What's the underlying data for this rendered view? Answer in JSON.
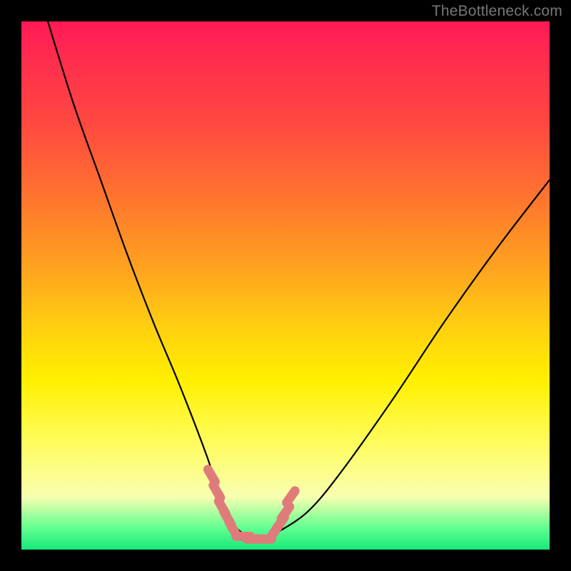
{
  "watermark": "TheBottleneck.com",
  "chart_data": {
    "type": "line",
    "title": "",
    "xlabel": "",
    "ylabel": "",
    "xlim": [
      0,
      100
    ],
    "ylim": [
      0,
      100
    ],
    "grid": false,
    "legend": false,
    "series": [
      {
        "name": "bottleneck-curve",
        "color": "#000000",
        "x": [
          5,
          10,
          15,
          20,
          25,
          30,
          35,
          38,
          40,
          42,
          44,
          46,
          48,
          54,
          60,
          70,
          80,
          90,
          100
        ],
        "y": [
          100,
          84,
          70,
          56,
          43,
          31,
          18,
          9,
          5,
          3,
          2,
          2,
          3,
          7,
          14,
          28,
          43,
          57,
          70
        ]
      },
      {
        "name": "optimal-zone-markers",
        "color": "#e07b7b",
        "type": "scatter",
        "x": [
          36,
          37,
          38,
          39,
          40,
          42,
          44,
          46,
          48,
          49,
          50,
          51
        ],
        "y": [
          14,
          11,
          8,
          6,
          4,
          2.5,
          2,
          2,
          3.5,
          5,
          7,
          10
        ]
      }
    ],
    "background_gradient": {
      "top": "#ff1a55",
      "mid": "#fff000",
      "bottom": "#17e87a"
    }
  }
}
